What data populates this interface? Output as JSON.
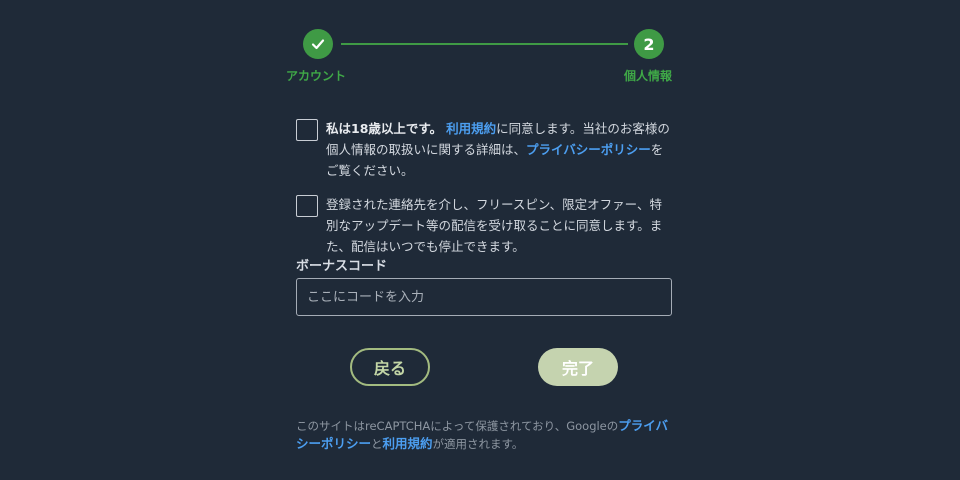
{
  "stepper": {
    "step1": {
      "label": "アカウント",
      "state": "completed",
      "icon": "check-icon"
    },
    "step2": {
      "number": "2",
      "label": "個人情報",
      "state": "active"
    }
  },
  "consent_age": {
    "prefix_bold": "私は18歳以上です。",
    "terms_link": "利用規約",
    "middle": "に同意します。当社のお客様の個人情報の取扱いに関する詳細は、",
    "privacy_link": "プライバシーポリシー",
    "suffix": "をご覧ください。"
  },
  "consent_marketing": {
    "text": "登録された連絡先を介し、フリースピン、限定オファー、特別なアップデート等の配信を受け取ることに同意します。また、配信はいつでも停止できます。"
  },
  "bonus": {
    "label": "ボーナスコード",
    "placeholder": "ここにコードを入力",
    "value": ""
  },
  "buttons": {
    "back": "戻る",
    "done": "完了"
  },
  "recaptcha": {
    "prefix": "このサイトはreCAPTCHAによって保護されており、Googleの",
    "privacy_link": "プライバシーポリシー",
    "and": "と",
    "terms_link": "利用規約",
    "suffix": "が適用されます。"
  },
  "colors": {
    "background": "#1f2a38",
    "accent_green": "#3f9a45",
    "link_blue": "#4c9ef0",
    "done_button": "#c5d3af"
  }
}
